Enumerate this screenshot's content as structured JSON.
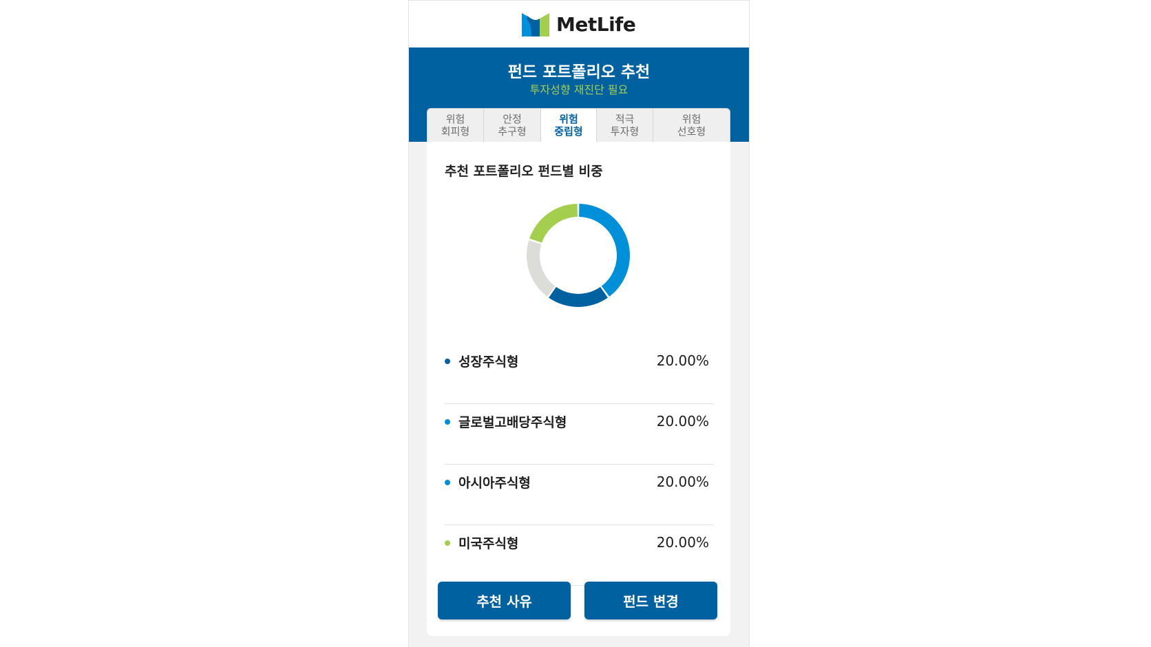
{
  "brand": {
    "name": "MetLife",
    "logo_colors": [
      "#0090da",
      "#0061a0",
      "#a4ce4e"
    ]
  },
  "header": {
    "title": "펀드 포트폴리오 추천",
    "subtitle": "투자성향 재진단 필요",
    "bg_color": "#0061a0",
    "subtitle_color": "#a4ce4e"
  },
  "tabs": [
    {
      "label": "위험\n회피형",
      "active": false
    },
    {
      "label": "안정\n추구형",
      "active": false
    },
    {
      "label": "위험\n중립형",
      "active": true
    },
    {
      "label": "적극\n투자형",
      "active": false
    },
    {
      "label": "위험\n선호형",
      "active": false
    }
  ],
  "card": {
    "title": "추천 포트폴리오 펀드별 비중"
  },
  "chart_data": {
    "type": "pie",
    "categories": [
      "성장주식형",
      "글로벌고배당주식형",
      "아시아주식형",
      "미국주식형"
    ],
    "segments": [
      {
        "label": "",
        "value": 40,
        "color": "#0090da"
      },
      {
        "label": "",
        "value": 20,
        "color": "#0061a0"
      },
      {
        "label": "",
        "value": 20,
        "color": "#dcdcd8"
      },
      {
        "label": "",
        "value": 20,
        "color": "#a4ce4e"
      }
    ]
  },
  "funds": [
    {
      "name": "성장주식형",
      "percent": "20.00%",
      "dot_color": "#0061a0"
    },
    {
      "name": "글로벌고배당주식형",
      "percent": "20.00%",
      "dot_color": "#0090da"
    },
    {
      "name": "아시아주식형",
      "percent": "20.00%",
      "dot_color": "#0090da"
    },
    {
      "name": "미국주식형",
      "percent": "20.00%",
      "dot_color": "#a4ce4e"
    }
  ],
  "buttons": {
    "reason_label": "추천 사유",
    "change_label": "펀드 변경"
  }
}
